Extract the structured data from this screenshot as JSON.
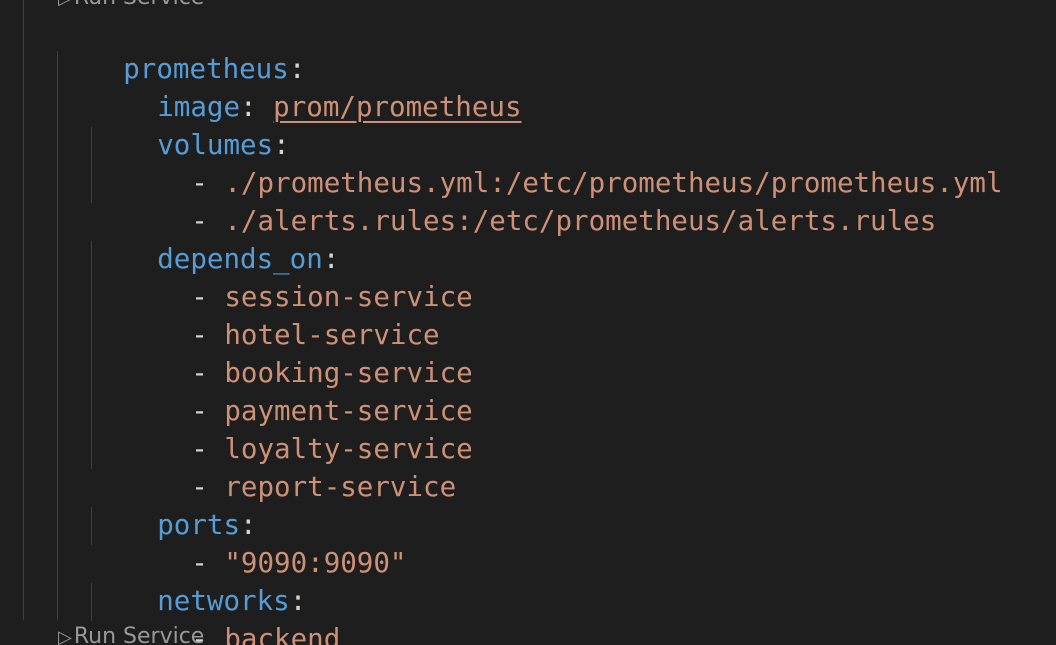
{
  "codelens_top": {
    "icon": "play-outline-icon",
    "glyph": "▷",
    "label": "Run Service"
  },
  "codelens_bottom": {
    "icon": "play-outline-icon",
    "glyph": "▷",
    "label": "Run Service"
  },
  "colors": {
    "background": "#1e1e1e",
    "key": "#569cd6",
    "string": "#ce9178",
    "punctuation": "#d4d4d4",
    "indent_guide": "#404040",
    "codelens": "#999999"
  },
  "code": {
    "service_key": "prometheus",
    "image_key": "image",
    "image_value": "prom/prometheus",
    "volumes_key": "volumes",
    "volumes": [
      "./prometheus.yml:/etc/prometheus/prometheus.yml",
      "./alerts.rules:/etc/prometheus/alerts.rules"
    ],
    "depends_on_key": "depends_on",
    "depends_on": [
      "session-service",
      "hotel-service",
      "booking-service",
      "payment-service",
      "loyalty-service",
      "report-service"
    ],
    "ports_key": "ports",
    "ports": [
      "\"9090:9090\""
    ],
    "networks_key": "networks",
    "networks": [
      "backend"
    ],
    "colon": ":",
    "dash": "- "
  }
}
